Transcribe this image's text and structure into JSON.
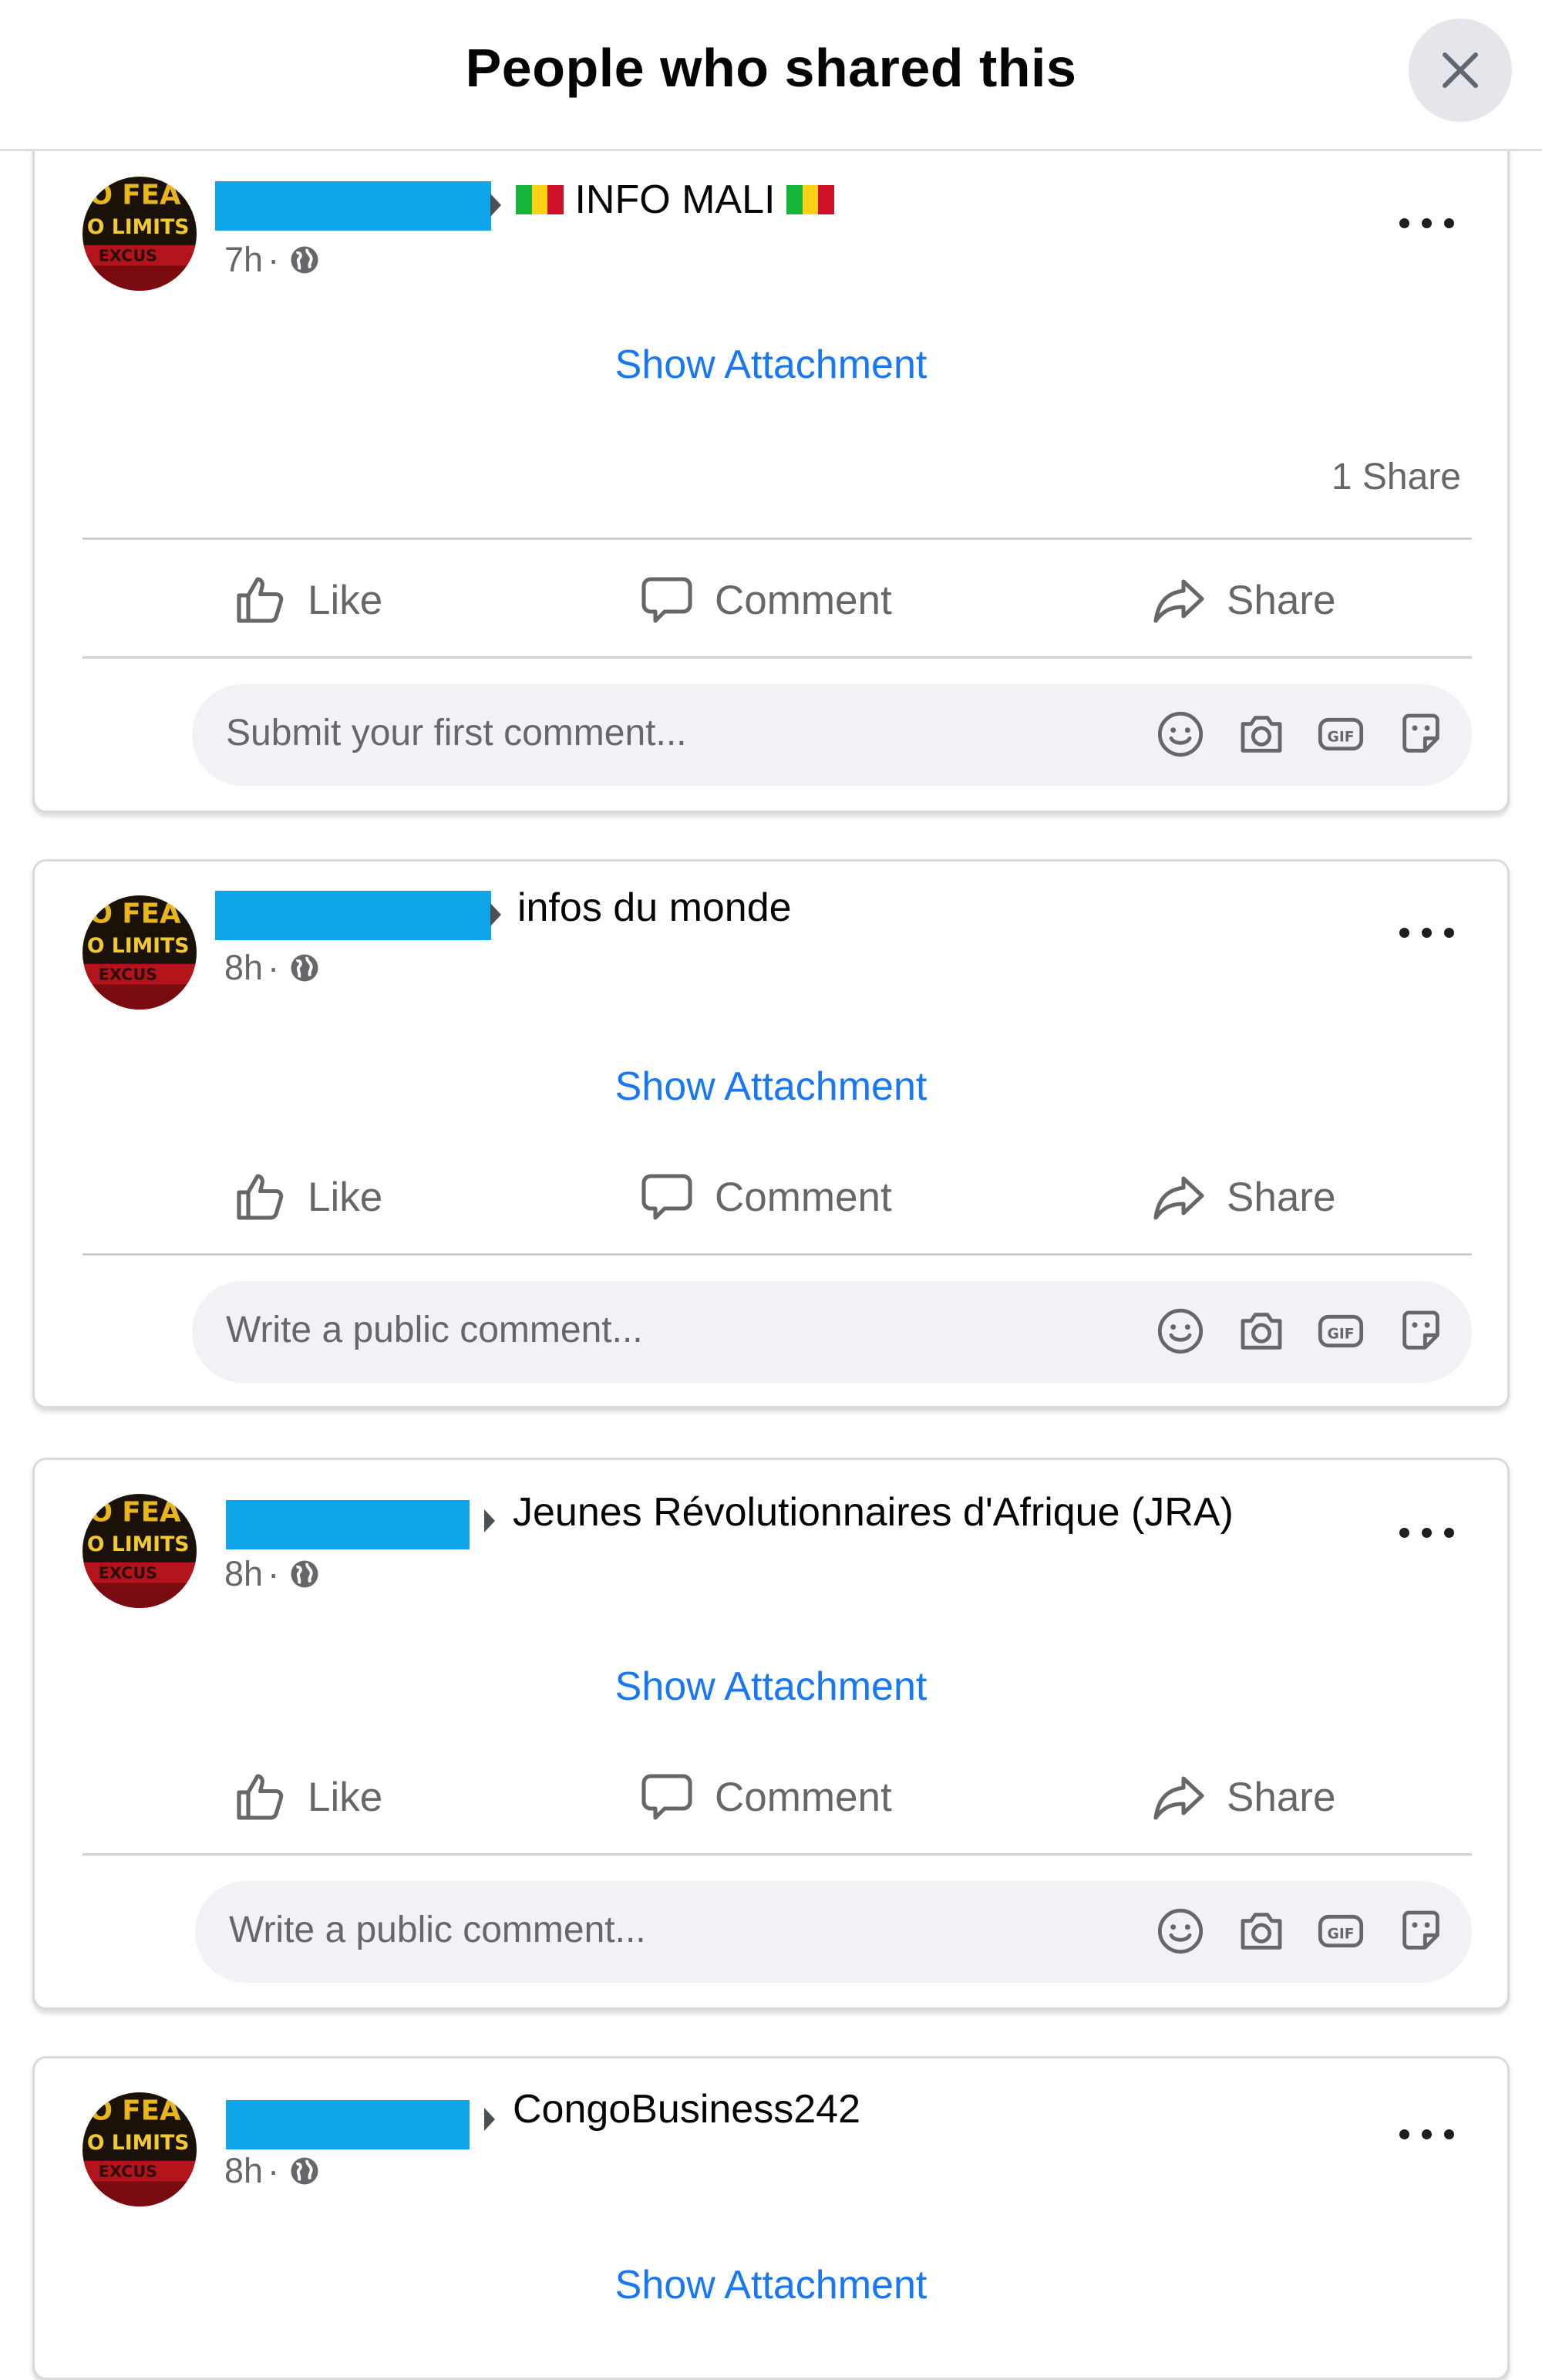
{
  "dialog": {
    "title": "People who shared this",
    "close_icon": "close-icon"
  },
  "posts": [
    {
      "target": "INFO MALI",
      "target_has_flags": true,
      "time": "7h",
      "separator": "·",
      "show_attachment": "Show Attachment",
      "share_count": "1 Share",
      "actions": {
        "like": "Like",
        "comment": "Comment",
        "share": "Share"
      },
      "comment_placeholder": "Submit your first comment..."
    },
    {
      "target": "infos du monde",
      "time": "8h",
      "separator": "·",
      "show_attachment": "Show Attachment",
      "actions": {
        "like": "Like",
        "comment": "Comment",
        "share": "Share"
      },
      "comment_placeholder": "Write a public comment..."
    },
    {
      "target": "Jeunes Révolutionnaires d'Afrique (JRA)",
      "time": "8h",
      "separator": "·",
      "show_attachment": "Show Attachment",
      "actions": {
        "like": "Like",
        "comment": "Comment",
        "share": "Share"
      },
      "comment_placeholder": "Write a public comment..."
    },
    {
      "target": "CongoBusiness242",
      "time": "8h",
      "separator": "·",
      "show_attachment": "Show Attachment"
    }
  ],
  "icons": {
    "audience": "globe-icon",
    "more": "more-options-icon",
    "like": "thumbs-up-icon",
    "comment": "comment-bubble-icon",
    "share": "share-arrow-icon",
    "emoji": "emoji-icon",
    "camera": "camera-icon",
    "gif": "gif-icon",
    "sticker": "sticker-icon"
  },
  "colors": {
    "link_blue": "#1877f2",
    "redaction": "#0ea5e9",
    "secondary_text": "#65676b",
    "input_bg": "#f0f2f5"
  }
}
